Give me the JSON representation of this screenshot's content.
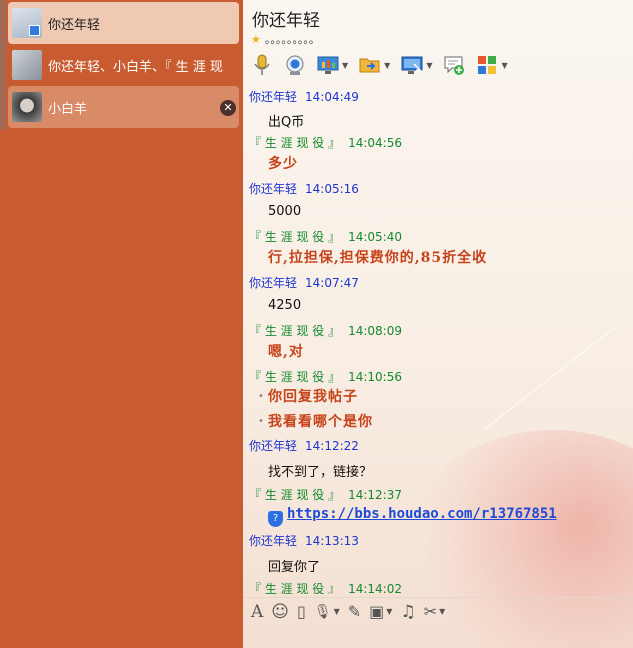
{
  "sidebar": {
    "conversations": [
      {
        "name": "你还年轻",
        "state": "selected"
      },
      {
        "name": "你还年轻、小白羊、『 生 涯 现",
        "state": "normal"
      },
      {
        "name": "小白羊",
        "state": "hover",
        "close_glyph": "✕"
      }
    ]
  },
  "header": {
    "title": "你还年轻",
    "signature": "。。。。。。。。。",
    "star_glyph": "★"
  },
  "toolbar": {
    "items": [
      {
        "icon": "microphone-icon",
        "has_menu": false
      },
      {
        "icon": "webcam-icon",
        "has_menu": false
      },
      {
        "icon": "screen-share-icon",
        "has_menu": true
      },
      {
        "icon": "send-file-icon",
        "has_menu": true
      },
      {
        "icon": "remote-desktop-icon",
        "has_menu": true
      },
      {
        "icon": "create-group-icon",
        "has_menu": false
      },
      {
        "icon": "apps-icon",
        "has_menu": true
      }
    ],
    "caret": "▼"
  },
  "messages": [
    {
      "sender": "你还年轻",
      "role": "me",
      "time": "14:04:49",
      "lines": [
        "出Q币"
      ],
      "style": "plain"
    },
    {
      "sender": "『 生 涯 现 役 』",
      "role": "other",
      "time": "14:04:56",
      "lines": [
        "多少"
      ],
      "style": "bold"
    },
    {
      "sender": "你还年轻",
      "role": "me",
      "time": "14:05:16",
      "lines": [
        "5000"
      ],
      "style": "plain"
    },
    {
      "sender": "『 生 涯 现 役 』",
      "role": "other",
      "time": "14:05:40",
      "lines": [
        "行,拉担保,担保费你的,85折全收"
      ],
      "style": "bold"
    },
    {
      "sender": "你还年轻",
      "role": "me",
      "time": "14:07:47",
      "lines": [
        "4250"
      ],
      "style": "plain"
    },
    {
      "sender": "『 生 涯 现 役 』",
      "role": "other",
      "time": "14:08:09",
      "lines": [
        "嗯,对"
      ],
      "style": "bold"
    },
    {
      "sender": "『 生 涯 现 役 』",
      "role": "other",
      "time": "14:10:56",
      "lines": [
        "你回复我帖子",
        "我看看哪个是你"
      ],
      "style": "bold-bullets"
    },
    {
      "sender": "你还年轻",
      "role": "me",
      "time": "14:12:22",
      "lines": [
        "找不到了，链接？"
      ],
      "style": "plain"
    },
    {
      "sender": "『 生 涯 现 役 』",
      "role": "other",
      "time": "14:12:37",
      "lines": [
        "https://bbs.houdao.com/r13767851"
      ],
      "style": "link"
    },
    {
      "sender": "你还年轻",
      "role": "me",
      "time": "14:13:13",
      "lines": [
        "回复你了"
      ],
      "style": "plain"
    },
    {
      "sender": "『 生 涯 现 役 』",
      "role": "other",
      "time": "14:14:02",
      "lines": [],
      "style": "plain"
    }
  ],
  "inputbar": {
    "items": [
      {
        "icon": "font-icon",
        "glyph": "A",
        "has_menu": false
      },
      {
        "icon": "emoji-icon",
        "glyph": "☺",
        "has_menu": false
      },
      {
        "icon": "vibrate-icon",
        "glyph": "▯",
        "has_menu": false
      },
      {
        "icon": "voice-message-icon",
        "glyph": "🎙",
        "has_menu": true
      },
      {
        "icon": "handwriting-icon",
        "glyph": "✎",
        "has_menu": false
      },
      {
        "icon": "image-icon",
        "glyph": "▣",
        "has_menu": true
      },
      {
        "icon": "music-icon",
        "glyph": "♫",
        "has_menu": false
      },
      {
        "icon": "screenshot-icon",
        "glyph": "✂",
        "has_menu": true
      }
    ]
  },
  "colors": {
    "sidebar_bg": "#c85c30",
    "me_name": "#1c35d4",
    "other_name": "#138a2c",
    "bold_text": "#c7431a"
  }
}
